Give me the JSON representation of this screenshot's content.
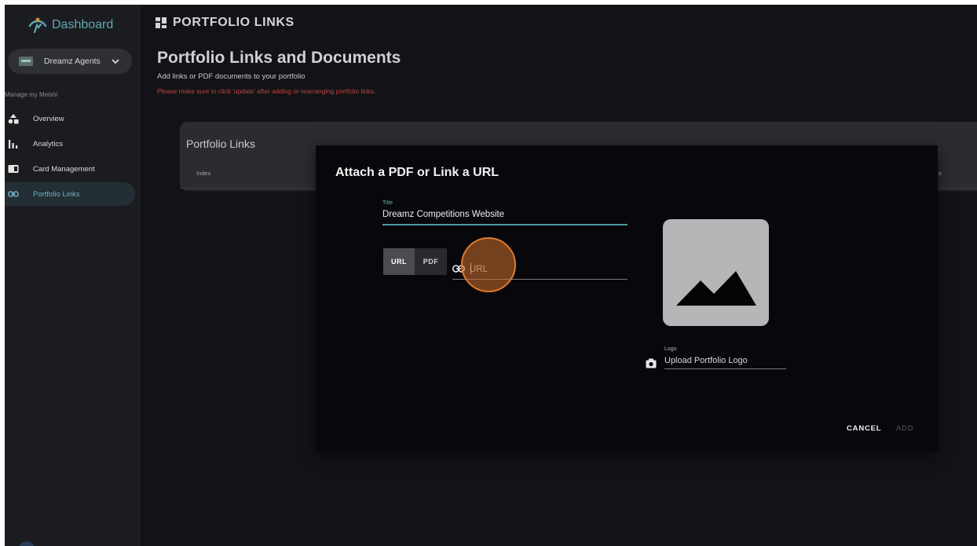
{
  "sidebar": {
    "brand": "Dashboard",
    "account_name": "Dreamz Agents",
    "section_label": "Manage my Meishi",
    "items": [
      {
        "label": "Overview",
        "icon": "shapes-icon"
      },
      {
        "label": "Analytics",
        "icon": "bar-chart-icon"
      },
      {
        "label": "Card Management",
        "icon": "card-icon"
      },
      {
        "label": "Portfolio Links",
        "icon": "link-icon",
        "active": true
      }
    ]
  },
  "header": {
    "title": "PORTFOLIO LINKS"
  },
  "main": {
    "title": "Portfolio Links and Documents",
    "subtitle": "Add links or PDF documents to your portfolio",
    "warning": "Please make sure to click 'update' after adding or rearranging portfolio links.",
    "card": {
      "title": "Portfolio Links",
      "col_index": "Index",
      "col_end": "e"
    }
  },
  "dialog": {
    "title": "Attach a PDF or Link a URL",
    "title_field": {
      "label": "Title",
      "value": "Dreamz Competitions Website"
    },
    "toggle": {
      "url_label": "URL",
      "pdf_label": "PDF",
      "selected": "URL"
    },
    "url_field": {
      "placeholder": "URL",
      "value": ""
    },
    "logo_field": {
      "label": "Logo",
      "value": "Upload Portfolio Logo"
    },
    "cancel_label": "CANCEL",
    "add_label": "ADD"
  },
  "colors": {
    "accent": "#5fa9b3",
    "warning": "#c0433e",
    "cursor_highlight": "#e17a2f"
  }
}
